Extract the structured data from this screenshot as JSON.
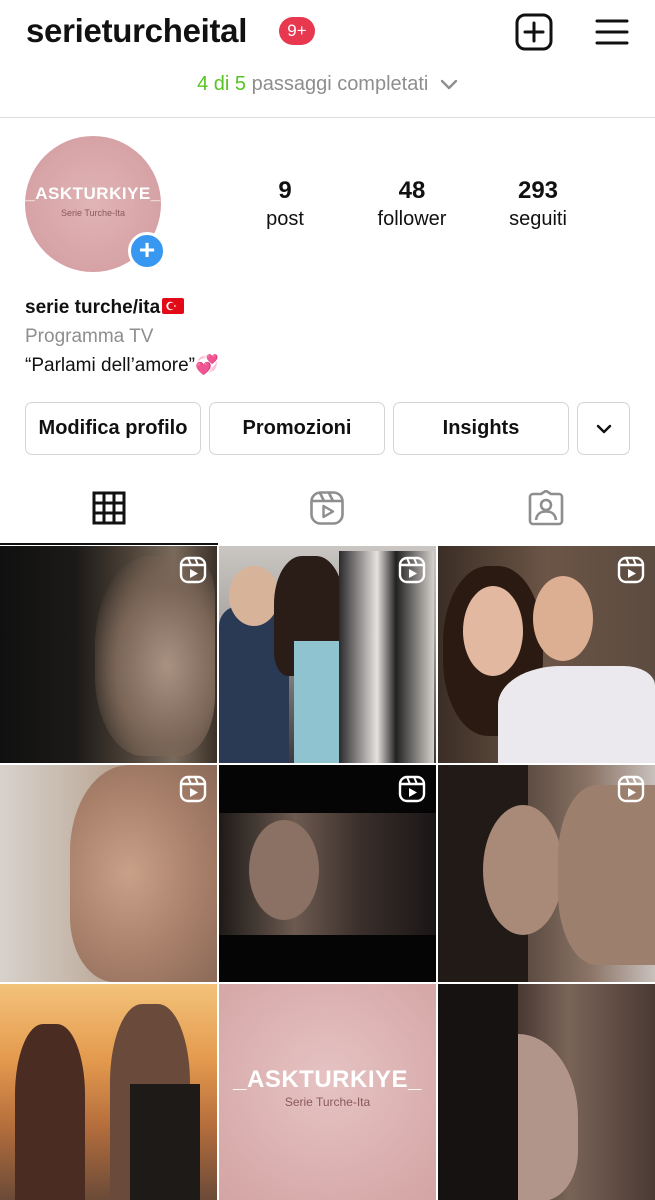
{
  "header": {
    "username": "serieturcheital",
    "notification_badge": "9+",
    "steps_done": "4 di 5",
    "steps_rest": " passaggi completati"
  },
  "profile": {
    "avatar_logo": "_ASKTURKIYE_",
    "avatar_sub": "Serie Turche-Ita",
    "stats": [
      {
        "num": "9",
        "label": "post"
      },
      {
        "num": "48",
        "label": "follower"
      },
      {
        "num": "293",
        "label": "seguiti"
      }
    ],
    "name": "serie turche/ita",
    "category": "Programma TV",
    "bio": "“Parlami dell’amore”💞"
  },
  "buttons": {
    "edit": "Modifica profilo",
    "promo": "Promozioni",
    "insights": "Insights"
  },
  "tabs": [
    "grid-tab",
    "reels-tab",
    "tagged-tab"
  ],
  "grid": {
    "tile_logo": "_ASKTURKIYE_",
    "tile_sub": "Serie Turche-Ita"
  },
  "colors": {
    "steps_done": "#58c322",
    "badge": "#e8384f",
    "add_button": "#3897f0",
    "avatar_bg": "#d6a2a5"
  }
}
